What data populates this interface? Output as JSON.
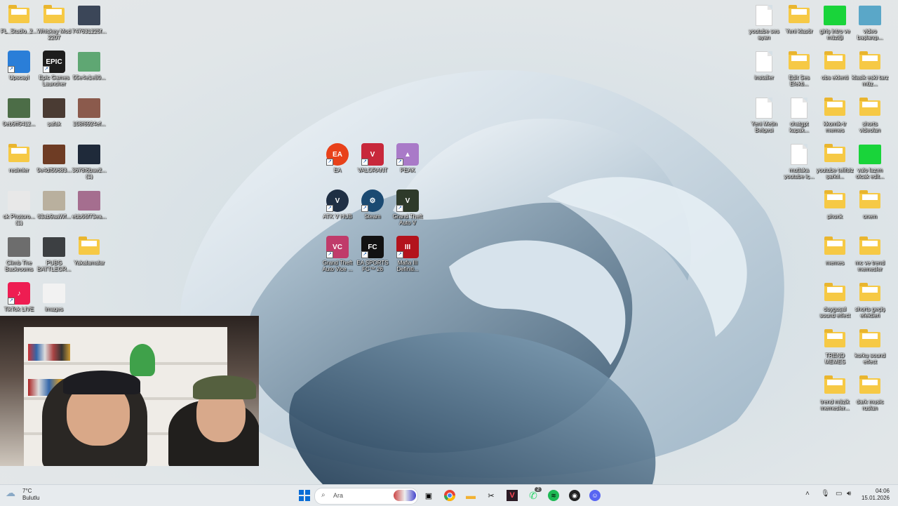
{
  "left_icons": [
    {
      "label": "FL_Studio_2...",
      "kind": "folder"
    },
    {
      "label": "Whiskey Mod 2207",
      "kind": "folder"
    },
    {
      "label": "747631225f...",
      "kind": "thumb",
      "color": "#3b4658"
    },
    {
      "label": "Upscayl",
      "kind": "app",
      "color": "#2a7ed8",
      "text": ""
    },
    {
      "label": "Epic Games Launcher",
      "kind": "app",
      "color": "#1d1d1d",
      "text": "EPIC"
    },
    {
      "label": "55e4e1e80...",
      "kind": "thumb",
      "color": "#5fa773"
    },
    {
      "label": "0eb9ff5412...",
      "kind": "thumb",
      "color": "#4c6d47"
    },
    {
      "label": "şafak",
      "kind": "thumb",
      "color": "#4a3b33"
    },
    {
      "label": "108f6924ef...",
      "kind": "thumb",
      "color": "#8b5a4c"
    },
    {
      "label": "resimler",
      "kind": "folder"
    },
    {
      "label": "9e4df59683...",
      "kind": "thumb",
      "color": "#6e3c24"
    },
    {
      "label": "3678f6bae2... (1)",
      "kind": "thumb",
      "color": "#1f2a3a"
    },
    {
      "label": "ok Photoro... (1)",
      "kind": "thumb",
      "color": "#e8e8e8"
    },
    {
      "label": "63ab9aaWf...",
      "kind": "thumb",
      "color": "#b9b09e"
    },
    {
      "label": "ebb66f73ea...",
      "kind": "thumb",
      "color": "#a56e8f"
    },
    {
      "label": "Climb The Backrooms",
      "kind": "thumb",
      "color": "#6d6d6d"
    },
    {
      "label": "PUBG BATTLEGR...",
      "kind": "thumb",
      "color": "#3c3f42"
    },
    {
      "label": "Yakalamalar",
      "kind": "folder"
    },
    {
      "label": "TikTok LIVE",
      "kind": "app",
      "color": "#ee1d52",
      "text": "♪"
    },
    {
      "label": "images",
      "kind": "thumb",
      "color": "#f2f2f2"
    }
  ],
  "center_icons": [
    {
      "label": "EA",
      "kind": "app",
      "color": "#e8411a",
      "text": "EA",
      "round": true
    },
    {
      "label": "VALORANT",
      "kind": "app",
      "color": "#c8283b",
      "text": "V"
    },
    {
      "label": "PEAK",
      "kind": "app",
      "color": "#a97ac8",
      "text": "▲"
    },
    {
      "label": "ATK V HUB",
      "kind": "app",
      "color": "#1f2f44",
      "text": "V",
      "round": true
    },
    {
      "label": "Steam",
      "kind": "app",
      "color": "#1b4a72",
      "text": "⚙",
      "round": true
    },
    {
      "label": "Grand Theft Auto V",
      "kind": "app",
      "color": "#2e3a2a",
      "text": "V"
    },
    {
      "label": "Grand Theft Auto Vice ...",
      "kind": "app",
      "color": "#c03b6a",
      "text": "VC"
    },
    {
      "label": "EA SPORTS FC™ 26",
      "kind": "app",
      "color": "#121212",
      "text": "FC"
    },
    {
      "label": "Mafia III Definiti...",
      "kind": "app",
      "color": "#b3131c",
      "text": "III"
    }
  ],
  "right_icons": [
    {
      "label": "youtube ses ayarı",
      "kind": "file"
    },
    {
      "label": "Yeni klasör",
      "kind": "folder"
    },
    {
      "label": "giriş intro ve müziği",
      "kind": "thumb",
      "color": "#19d43a"
    },
    {
      "label": "video başlangı...",
      "kind": "thumb",
      "color": "#5aa7c8"
    },
    {
      "label": "installer",
      "kind": "file"
    },
    {
      "label": "Edit Ses Efekti...",
      "kind": "folder"
    },
    {
      "label": "obs eklenti",
      "kind": "folder"
    },
    {
      "label": "klasik eski tarz müz...",
      "kind": "folder"
    },
    {
      "label": "Yeni Metin Belgesi",
      "kind": "file"
    },
    {
      "label": "chatgpt kapak...",
      "kind": "file"
    },
    {
      "label": "kkomik-tr memes",
      "kind": "folder"
    },
    {
      "label": "shorts videoları",
      "kind": "folder"
    },
    {
      "label": "mutlaka youtube iç...",
      "kind": "file"
    },
    {
      "label": "youtube telifsiz şarkıl...",
      "kind": "folder"
    },
    {
      "label": "valo lazım olcak edit...",
      "kind": "thumb",
      "color": "#19d43a"
    },
    {
      "label": "phonk",
      "kind": "folder"
    },
    {
      "label": "onem",
      "kind": "folder"
    },
    {
      "label": "memes",
      "kind": "folder"
    },
    {
      "label": "mc ve trend memesler",
      "kind": "folder"
    },
    {
      "label": "duygusal sound effect",
      "kind": "folder"
    },
    {
      "label": "shorts geçiş efektleri",
      "kind": "folder"
    },
    {
      "label": "TREND MEMES",
      "kind": "folder"
    },
    {
      "label": "korku sound effect",
      "kind": "folder"
    },
    {
      "label": "trend müzik memesler...",
      "kind": "folder"
    },
    {
      "label": "dark music ruslan",
      "kind": "folder"
    }
  ],
  "taskbar": {
    "weather_temp": "7°C",
    "weather_desc": "Bulutlu",
    "search_placeholder": "Ara",
    "time": "04:06",
    "date": "15.01.2026",
    "whatsapp_badge": "2",
    "apps": [
      {
        "name": "start-button",
        "glyph": "⊞",
        "color": "#0a6cd6"
      },
      {
        "name": "task-view-button",
        "glyph": "▣",
        "color": "#333"
      },
      {
        "name": "chrome-button",
        "glyph": "●",
        "color": "#e84334"
      },
      {
        "name": "file-explorer-button",
        "glyph": "▬",
        "color": "#f2b233"
      },
      {
        "name": "capcut-button",
        "glyph": "✂",
        "color": "#111"
      },
      {
        "name": "valorant-button",
        "glyph": "V",
        "color": "#c8283b"
      },
      {
        "name": "whatsapp-button",
        "glyph": "✆",
        "color": "#25d366"
      },
      {
        "name": "spotify-button",
        "glyph": "♫",
        "color": "#1db954"
      },
      {
        "name": "obs-button",
        "glyph": "◉",
        "color": "#222"
      },
      {
        "name": "discord-button",
        "glyph": "☺",
        "color": "#5865f2"
      }
    ]
  }
}
